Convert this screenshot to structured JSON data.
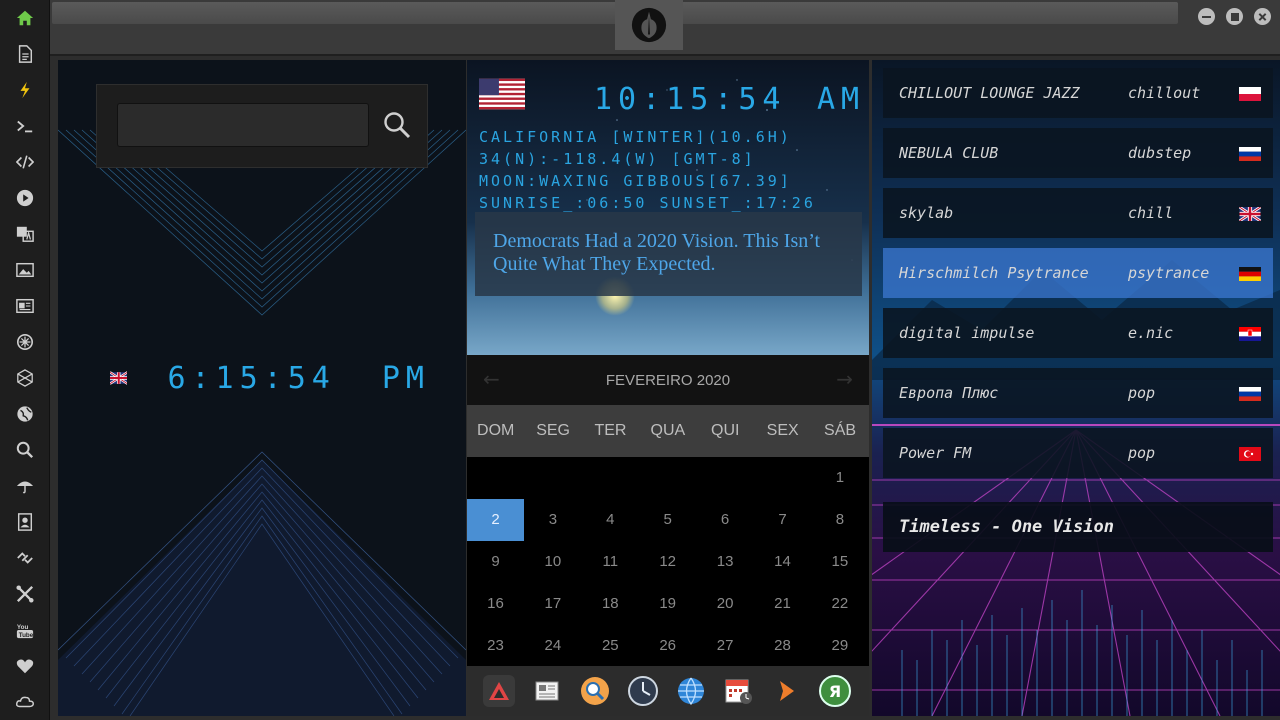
{
  "sidebar": {
    "items": [
      {
        "name": "home-icon"
      },
      {
        "name": "document-icon"
      },
      {
        "name": "lightning-icon"
      },
      {
        "name": "terminal-icon"
      },
      {
        "name": "code-icon"
      },
      {
        "name": "play-icon"
      },
      {
        "name": "translate-icon"
      },
      {
        "name": "image-icon"
      },
      {
        "name": "newspaper-icon"
      },
      {
        "name": "settings-badge-icon"
      },
      {
        "name": "hexagon-icon"
      },
      {
        "name": "globe-icon"
      },
      {
        "name": "search-icon"
      },
      {
        "name": "umbrella-icon"
      },
      {
        "name": "contacts-icon"
      },
      {
        "name": "link-icon"
      },
      {
        "name": "tools-icon"
      },
      {
        "name": "youtube-icon"
      },
      {
        "name": "heart-icon"
      },
      {
        "name": "cloud-icon"
      }
    ]
  },
  "search": {
    "value": "",
    "placeholder": ""
  },
  "uk_clock": {
    "time": "6:15:54",
    "ampm": "PM"
  },
  "world": {
    "time": "10:15:54",
    "ampm": "AM",
    "lines": [
      "CALIFORNIA [WINTER](10.6H)",
      "34(N):-118.4(W) [GMT-8]",
      "MOON:WAXING GIBBOUS[67.39]",
      "SUNRISE_:06:50 SUNSET_:17:26"
    ],
    "headline": "Democrats Had a 2020 Vision. This Isn’t Quite What They Expected."
  },
  "calendar": {
    "month_label": "FEVEREIRO 2020",
    "prev_label": "←",
    "next_label": "→",
    "weekdays": [
      "DOM",
      "SEG",
      "TER",
      "QUA",
      "QUI",
      "SEX",
      "SÁB"
    ],
    "days": [
      "",
      "",
      "",
      "",
      "",
      "",
      "1",
      "2",
      "3",
      "4",
      "5",
      "6",
      "7",
      "8",
      "9",
      "10",
      "11",
      "12",
      "13",
      "14",
      "15",
      "16",
      "17",
      "18",
      "19",
      "20",
      "21",
      "22",
      "23",
      "24",
      "25",
      "26",
      "27",
      "28",
      "29"
    ],
    "selected": "2"
  },
  "dock": {
    "items": [
      {
        "name": "triangle-app-icon",
        "color": "#c0392b"
      },
      {
        "name": "news-app-icon",
        "color": "#e9e9e9"
      },
      {
        "name": "search-app-icon",
        "color": "#f3a34a"
      },
      {
        "name": "clock-app-icon",
        "color": "#cdd6e0"
      },
      {
        "name": "globe-app-icon",
        "color": "#2f86d8"
      },
      {
        "name": "calendar-app-icon",
        "color": "#e74c3c"
      },
      {
        "name": "arrow-app-icon",
        "color": "#ef7d2b"
      },
      {
        "name": "yandex-app-icon",
        "color": "#5aa45a"
      }
    ],
    "yandex_glyph": "Я"
  },
  "stations": [
    {
      "name": "CHILLOUT LOUNGE JAZZ",
      "genre": "chillout",
      "flag": "poland"
    },
    {
      "name": "NEBULA CLUB",
      "genre": "dubstep",
      "flag": "russia"
    },
    {
      "name": "skylab",
      "genre": "chill",
      "flag": "uk"
    },
    {
      "name": "Hirschmilch Psytrance",
      "genre": "psytrance",
      "flag": "germany"
    },
    {
      "name": "digital impulse",
      "genre": "e.nic",
      "flag": "croatia"
    },
    {
      "name": "Европа Плюс",
      "genre": "pop",
      "flag": "russia"
    },
    {
      "name": "Power FM",
      "genre": "pop",
      "flag": "turkey"
    }
  ],
  "now_playing": "Timeless - One Vision",
  "colors": {
    "accent": "#29a8e6",
    "selected_day": "#4a8fd3",
    "active_station": "#3c78d2"
  }
}
